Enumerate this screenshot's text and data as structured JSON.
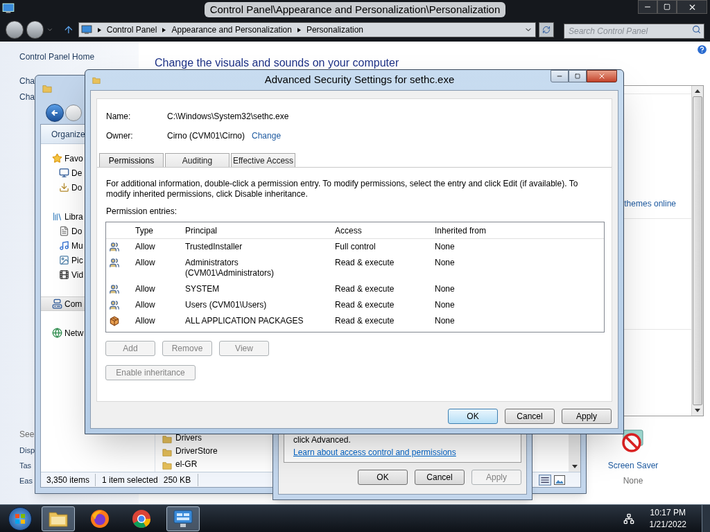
{
  "control_panel": {
    "title": "Control Panel\\Appearance and Personalization\\Personalization",
    "breadcrumbs": [
      "Control Panel",
      "Appearance and Personalization",
      "Personalization"
    ],
    "search": {
      "placeholder": "Search Control Panel"
    },
    "sidebar": {
      "items": [
        "Control Panel Home",
        "Cha",
        "Cha"
      ],
      "see_also": "See",
      "see_also_items": [
        "Disp",
        "Tas",
        "Eas"
      ]
    },
    "heading": "Change the visuals and sounds on your computer",
    "themes_link": "themes online",
    "screen_saver": {
      "label": "Screen Saver",
      "value": "None"
    }
  },
  "explorer": {
    "toolbar": "Organize",
    "nav": [
      {
        "label": "Favo",
        "kind": "star",
        "selected": false,
        "children": [
          {
            "label": "De",
            "kind": "desktop",
            "selected": false
          },
          {
            "label": "Do",
            "kind": "downloads",
            "selected": false
          }
        ]
      },
      {
        "label": "Libra",
        "kind": "library",
        "selected": false,
        "children": [
          {
            "label": "Do",
            "kind": "document",
            "selected": false
          },
          {
            "label": "Mu",
            "kind": "music",
            "selected": false
          },
          {
            "label": "Pic",
            "kind": "picture",
            "selected": false
          },
          {
            "label": "Vid",
            "kind": "video",
            "selected": false
          }
        ]
      },
      {
        "label": "Com",
        "kind": "computer",
        "selected": true
      },
      {
        "label": "Netw",
        "kind": "network",
        "selected": false
      }
    ],
    "files": [
      "Drivers",
      "DriverStore",
      "el-GR"
    ],
    "status": {
      "count": "3,350 items",
      "selection": "1 item selected",
      "size": "250 KB"
    }
  },
  "properties_dialog": {
    "text": "click Advanced.",
    "link": "Learn about access control and permissions",
    "buttons": [
      {
        "label": "OK",
        "disabled": false
      },
      {
        "label": "Cancel",
        "disabled": false
      },
      {
        "label": "Apply",
        "disabled": true
      }
    ]
  },
  "security_dialog": {
    "title": "Advanced Security Settings for sethc.exe",
    "name_label": "Name:",
    "name": "C:\\Windows\\System32\\sethc.exe",
    "owner_label": "Owner:",
    "owner": "Cirno (CVM01\\Cirno)",
    "change_link": "Change",
    "tabs": [
      {
        "label": "Permissions",
        "selected": true
      },
      {
        "label": "Auditing",
        "selected": false
      },
      {
        "label": "Effective Access",
        "selected": false
      }
    ],
    "info": "For additional information, double-click a permission entry. To modify permissions, select the entry and click Edit (if available). To modify inherited permissions, click Disable inheritance.",
    "entries_label": "Permission entries:",
    "columns": [
      "Type",
      "Principal",
      "Access",
      "Inherited from"
    ],
    "rows": [
      {
        "kind": "group",
        "type": "Allow",
        "principal": "TrustedInstaller",
        "access": "Full control",
        "inherited": "None"
      },
      {
        "kind": "group",
        "type": "Allow",
        "principal": "Administrators (CVM01\\Administrators)",
        "access": "Read & execute",
        "inherited": "None"
      },
      {
        "kind": "group",
        "type": "Allow",
        "principal": "SYSTEM",
        "access": "Read & execute",
        "inherited": "None"
      },
      {
        "kind": "group",
        "type": "Allow",
        "principal": "Users (CVM01\\Users)",
        "access": "Read & execute",
        "inherited": "None"
      },
      {
        "kind": "package",
        "type": "Allow",
        "principal": "ALL APPLICATION PACKAGES",
        "access": "Read & execute",
        "inherited": "None"
      }
    ],
    "entry_buttons": [
      {
        "label": "Add",
        "disabled": true
      },
      {
        "label": "Remove",
        "disabled": true
      },
      {
        "label": "View",
        "disabled": true
      }
    ],
    "inheritance_button": {
      "label": "Enable inheritance",
      "disabled": true
    },
    "buttons": [
      {
        "label": "OK",
        "default": true
      },
      {
        "label": "Cancel",
        "default": false
      },
      {
        "label": "Apply",
        "default": false
      }
    ]
  },
  "taskbar": {
    "apps": [
      {
        "kind": "explorer",
        "active": true
      },
      {
        "kind": "firefox",
        "active": false
      },
      {
        "kind": "chrome",
        "active": false
      },
      {
        "kind": "control-panel",
        "active": true
      }
    ],
    "time": "10:17 PM",
    "date": "1/21/2022"
  }
}
